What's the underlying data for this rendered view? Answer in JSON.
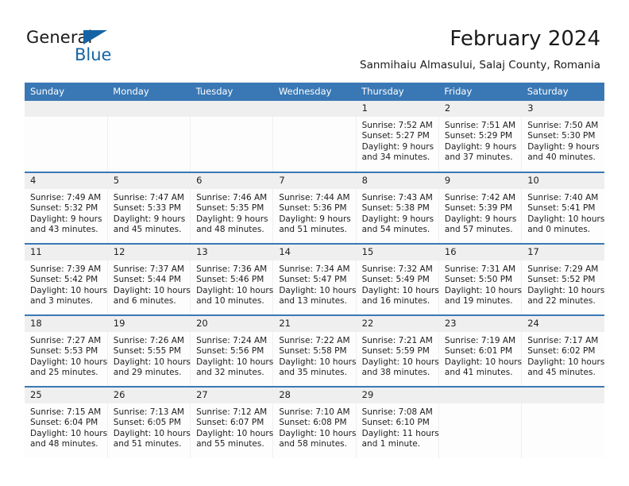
{
  "brand": {
    "name_top": "General",
    "name_bottom": "Blue",
    "triangle_icon": "triangle-logo-icon",
    "accent_color": "#1464a5"
  },
  "header": {
    "title": "February 2024",
    "location": "Sanmihaiu Almasului, Salaj County, Romania"
  },
  "theme": {
    "header_blue": "#3a78b5",
    "daynum_band": "#efefef",
    "cell_bg": "#fdfdfd",
    "text": "#1d1d1d"
  },
  "calendar": {
    "weekday_headers": [
      "Sunday",
      "Monday",
      "Tuesday",
      "Wednesday",
      "Thursday",
      "Friday",
      "Saturday"
    ],
    "weeks": [
      [
        {
          "day": "",
          "empty": true
        },
        {
          "day": "",
          "empty": true
        },
        {
          "day": "",
          "empty": true
        },
        {
          "day": "",
          "empty": true
        },
        {
          "day": "1",
          "sunrise": "Sunrise: 7:52 AM",
          "sunset": "Sunset: 5:27 PM",
          "daylight1": "Daylight: 9 hours",
          "daylight2": "and 34 minutes."
        },
        {
          "day": "2",
          "sunrise": "Sunrise: 7:51 AM",
          "sunset": "Sunset: 5:29 PM",
          "daylight1": "Daylight: 9 hours",
          "daylight2": "and 37 minutes."
        },
        {
          "day": "3",
          "sunrise": "Sunrise: 7:50 AM",
          "sunset": "Sunset: 5:30 PM",
          "daylight1": "Daylight: 9 hours",
          "daylight2": "and 40 minutes."
        }
      ],
      [
        {
          "day": "4",
          "sunrise": "Sunrise: 7:49 AM",
          "sunset": "Sunset: 5:32 PM",
          "daylight1": "Daylight: 9 hours",
          "daylight2": "and 43 minutes."
        },
        {
          "day": "5",
          "sunrise": "Sunrise: 7:47 AM",
          "sunset": "Sunset: 5:33 PM",
          "daylight1": "Daylight: 9 hours",
          "daylight2": "and 45 minutes."
        },
        {
          "day": "6",
          "sunrise": "Sunrise: 7:46 AM",
          "sunset": "Sunset: 5:35 PM",
          "daylight1": "Daylight: 9 hours",
          "daylight2": "and 48 minutes."
        },
        {
          "day": "7",
          "sunrise": "Sunrise: 7:44 AM",
          "sunset": "Sunset: 5:36 PM",
          "daylight1": "Daylight: 9 hours",
          "daylight2": "and 51 minutes."
        },
        {
          "day": "8",
          "sunrise": "Sunrise: 7:43 AM",
          "sunset": "Sunset: 5:38 PM",
          "daylight1": "Daylight: 9 hours",
          "daylight2": "and 54 minutes."
        },
        {
          "day": "9",
          "sunrise": "Sunrise: 7:42 AM",
          "sunset": "Sunset: 5:39 PM",
          "daylight1": "Daylight: 9 hours",
          "daylight2": "and 57 minutes."
        },
        {
          "day": "10",
          "sunrise": "Sunrise: 7:40 AM",
          "sunset": "Sunset: 5:41 PM",
          "daylight1": "Daylight: 10 hours",
          "daylight2": "and 0 minutes."
        }
      ],
      [
        {
          "day": "11",
          "sunrise": "Sunrise: 7:39 AM",
          "sunset": "Sunset: 5:42 PM",
          "daylight1": "Daylight: 10 hours",
          "daylight2": "and 3 minutes."
        },
        {
          "day": "12",
          "sunrise": "Sunrise: 7:37 AM",
          "sunset": "Sunset: 5:44 PM",
          "daylight1": "Daylight: 10 hours",
          "daylight2": "and 6 minutes."
        },
        {
          "day": "13",
          "sunrise": "Sunrise: 7:36 AM",
          "sunset": "Sunset: 5:46 PM",
          "daylight1": "Daylight: 10 hours",
          "daylight2": "and 10 minutes."
        },
        {
          "day": "14",
          "sunrise": "Sunrise: 7:34 AM",
          "sunset": "Sunset: 5:47 PM",
          "daylight1": "Daylight: 10 hours",
          "daylight2": "and 13 minutes."
        },
        {
          "day": "15",
          "sunrise": "Sunrise: 7:32 AM",
          "sunset": "Sunset: 5:49 PM",
          "daylight1": "Daylight: 10 hours",
          "daylight2": "and 16 minutes."
        },
        {
          "day": "16",
          "sunrise": "Sunrise: 7:31 AM",
          "sunset": "Sunset: 5:50 PM",
          "daylight1": "Daylight: 10 hours",
          "daylight2": "and 19 minutes."
        },
        {
          "day": "17",
          "sunrise": "Sunrise: 7:29 AM",
          "sunset": "Sunset: 5:52 PM",
          "daylight1": "Daylight: 10 hours",
          "daylight2": "and 22 minutes."
        }
      ],
      [
        {
          "day": "18",
          "sunrise": "Sunrise: 7:27 AM",
          "sunset": "Sunset: 5:53 PM",
          "daylight1": "Daylight: 10 hours",
          "daylight2": "and 25 minutes."
        },
        {
          "day": "19",
          "sunrise": "Sunrise: 7:26 AM",
          "sunset": "Sunset: 5:55 PM",
          "daylight1": "Daylight: 10 hours",
          "daylight2": "and 29 minutes."
        },
        {
          "day": "20",
          "sunrise": "Sunrise: 7:24 AM",
          "sunset": "Sunset: 5:56 PM",
          "daylight1": "Daylight: 10 hours",
          "daylight2": "and 32 minutes."
        },
        {
          "day": "21",
          "sunrise": "Sunrise: 7:22 AM",
          "sunset": "Sunset: 5:58 PM",
          "daylight1": "Daylight: 10 hours",
          "daylight2": "and 35 minutes."
        },
        {
          "day": "22",
          "sunrise": "Sunrise: 7:21 AM",
          "sunset": "Sunset: 5:59 PM",
          "daylight1": "Daylight: 10 hours",
          "daylight2": "and 38 minutes."
        },
        {
          "day": "23",
          "sunrise": "Sunrise: 7:19 AM",
          "sunset": "Sunset: 6:01 PM",
          "daylight1": "Daylight: 10 hours",
          "daylight2": "and 41 minutes."
        },
        {
          "day": "24",
          "sunrise": "Sunrise: 7:17 AM",
          "sunset": "Sunset: 6:02 PM",
          "daylight1": "Daylight: 10 hours",
          "daylight2": "and 45 minutes."
        }
      ],
      [
        {
          "day": "25",
          "sunrise": "Sunrise: 7:15 AM",
          "sunset": "Sunset: 6:04 PM",
          "daylight1": "Daylight: 10 hours",
          "daylight2": "and 48 minutes."
        },
        {
          "day": "26",
          "sunrise": "Sunrise: 7:13 AM",
          "sunset": "Sunset: 6:05 PM",
          "daylight1": "Daylight: 10 hours",
          "daylight2": "and 51 minutes."
        },
        {
          "day": "27",
          "sunrise": "Sunrise: 7:12 AM",
          "sunset": "Sunset: 6:07 PM",
          "daylight1": "Daylight: 10 hours",
          "daylight2": "and 55 minutes."
        },
        {
          "day": "28",
          "sunrise": "Sunrise: 7:10 AM",
          "sunset": "Sunset: 6:08 PM",
          "daylight1": "Daylight: 10 hours",
          "daylight2": "and 58 minutes."
        },
        {
          "day": "29",
          "sunrise": "Sunrise: 7:08 AM",
          "sunset": "Sunset: 6:10 PM",
          "daylight1": "Daylight: 11 hours",
          "daylight2": "and 1 minute."
        },
        {
          "day": "",
          "empty": true
        },
        {
          "day": "",
          "empty": true
        }
      ]
    ]
  }
}
